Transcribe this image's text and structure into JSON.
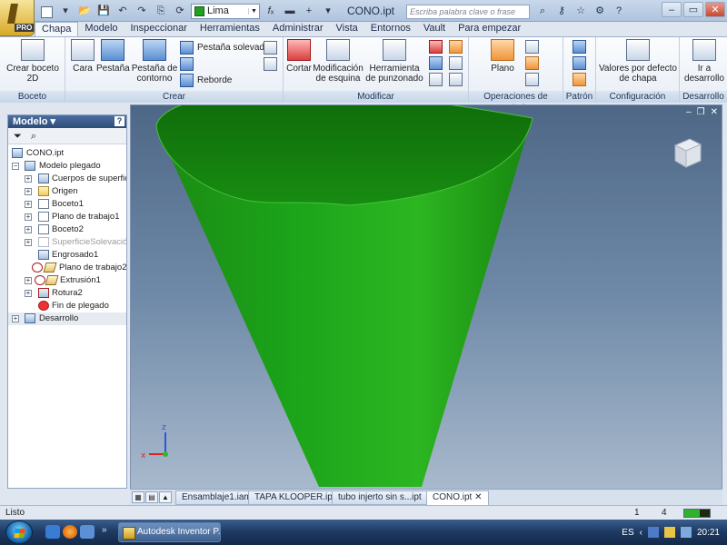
{
  "titlebar": {
    "document_title": "CONO.ipt",
    "search_placeholder": "Escriba palabra clave o frase",
    "color_value": "Lima",
    "app_badge": "PRO",
    "help_label": "?"
  },
  "tabs": [
    "Chapa",
    "Modelo",
    "Inspeccionar",
    "Herramientas",
    "Administrar",
    "Vista",
    "Entornos",
    "Vault",
    "Para empezar"
  ],
  "ribbon": {
    "boceto": {
      "crear_boceto": "Crear boceto 2D",
      "label": "Boceto"
    },
    "crear": {
      "cara": "Cara",
      "pestana": "Pestaña",
      "pestana_contorno": "Pestaña de contorno",
      "pestana_solevada": "Pestaña solevada",
      "reborde": "Reborde",
      "label": "Crear"
    },
    "modificar": {
      "cortar": "Cortar",
      "modificacion_esquina": "Modificación de esquina",
      "herramienta_punzonado": "Herramienta de punzonado",
      "label": "Modificar"
    },
    "operaciones": {
      "plano": "Plano",
      "label": "Operaciones de trabajo"
    },
    "patron": {
      "label": "Patrón"
    },
    "configuracion": {
      "valores_defecto": "Valores por defecto de chapa",
      "label": "Configuración"
    },
    "desarrollo": {
      "ir_desarrollo": "Ir a desarrollo",
      "label": "Desarrollo"
    }
  },
  "browser": {
    "title": "Modelo",
    "help": "?",
    "tree": [
      {
        "label": "CONO.ipt",
        "level": 0,
        "toggle": "",
        "icon": "part-icon",
        "dim": false
      },
      {
        "label": "Modelo plegado",
        "level": 0,
        "toggle": "−",
        "icon": "folded-model-icon",
        "dim": false
      },
      {
        "label": "Cuerpos de superficie",
        "level": 1,
        "toggle": "+",
        "icon": "surface-bodies-icon",
        "dim": false
      },
      {
        "label": "Origen",
        "level": 1,
        "toggle": "+",
        "icon": "folder-icon",
        "dim": false
      },
      {
        "label": "Boceto1",
        "level": 1,
        "toggle": "+",
        "icon": "sketch-icon",
        "dim": false
      },
      {
        "label": "Plano de trabajo1",
        "level": 1,
        "toggle": "+",
        "icon": "work-plane-icon",
        "dim": false
      },
      {
        "label": "Boceto2",
        "level": 1,
        "toggle": "+",
        "icon": "sketch-icon",
        "dim": false
      },
      {
        "label": "SuperficieSolevación2",
        "level": 1,
        "toggle": "+",
        "icon": "loft-surface-icon",
        "dim": true
      },
      {
        "label": "Engrosado1",
        "level": 1,
        "toggle": "",
        "icon": "thicken-icon",
        "dim": false
      },
      {
        "label": "Plano de trabajo2",
        "level": 1,
        "toggle": "",
        "icon": "work-plane-warning-icon",
        "dim": false
      },
      {
        "label": "Extrusión1",
        "level": 1,
        "toggle": "+",
        "icon": "extrusion-icon",
        "dim": false
      },
      {
        "label": "Rotura2",
        "level": 1,
        "toggle": "+",
        "icon": "rip-icon",
        "dim": false
      },
      {
        "label": "Fin de plegado",
        "level": 1,
        "toggle": "",
        "icon": "end-of-fold-icon",
        "dim": false
      },
      {
        "label": "Desarrollo",
        "level": 0,
        "toggle": "+",
        "icon": "flat-pattern-icon",
        "dim": false
      }
    ]
  },
  "doc_tabs": [
    "Ensamblaje1.iam",
    "TAPA KLOOPER.ipt",
    "tubo injerto  sin s...ipt",
    "CONO.ipt"
  ],
  "status": {
    "text": "Listo",
    "count1": "1",
    "count2": "4",
    "progress_fraction": 0.6
  },
  "taskbar": {
    "task_label": "Autodesk Inventor P...",
    "language": "ES",
    "time": "20:21"
  },
  "colors": {
    "model_green": "#1fa01f",
    "ribbon_blue": "#c6d5e8"
  }
}
